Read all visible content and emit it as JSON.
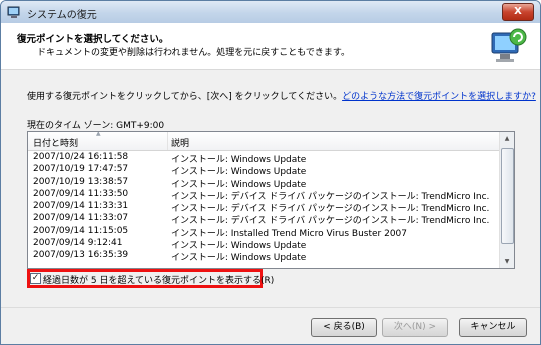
{
  "window": {
    "title": "システムの復元",
    "close_label": "X"
  },
  "header": {
    "title": "復元ポイントを選択してください。",
    "subtitle": "ドキュメントの変更や削除は行われません。処理を元に戻すこともできます。"
  },
  "instruction": {
    "text": "使用する復元ポイントをクリックしてから、[次へ] をクリックしてください。",
    "link": "どのような方法で復元ポイントを選択しますか?"
  },
  "timezone": "現在のタイム ゾーン: GMT+9:00",
  "table": {
    "columns": [
      "日付と時刻",
      "説明"
    ],
    "rows": [
      [
        "2007/10/24 16:11:58",
        "インストール: Windows Update"
      ],
      [
        "2007/10/19 17:47:57",
        "インストール: Windows Update"
      ],
      [
        "2007/10/19 13:38:57",
        "インストール: Windows Update"
      ],
      [
        "2007/09/14 11:33:50",
        "インストール: デバイス ドライバ パッケージのインストール: TrendMicro Inc."
      ],
      [
        "2007/09/14 11:33:31",
        "インストール: デバイス ドライバ パッケージのインストール: TrendMicro Inc."
      ],
      [
        "2007/09/14 11:33:07",
        "インストール: デバイス ドライバ パッケージのインストール: TrendMicro Inc."
      ],
      [
        "2007/09/14 11:15:05",
        "インストール: Installed Trend Micro Virus Buster 2007"
      ],
      [
        "2007/09/14 9:12:41",
        "インストール: Windows Update"
      ],
      [
        "2007/09/13 16:35:39",
        "インストール: Windows Update"
      ]
    ]
  },
  "checkbox": {
    "label": "経過日数が 5 日を超えている復元ポイントを表示する(R)",
    "checked": true
  },
  "buttons": {
    "back": "< 戻る(B)",
    "next": "次へ(N) >",
    "cancel": "キャンセル"
  }
}
